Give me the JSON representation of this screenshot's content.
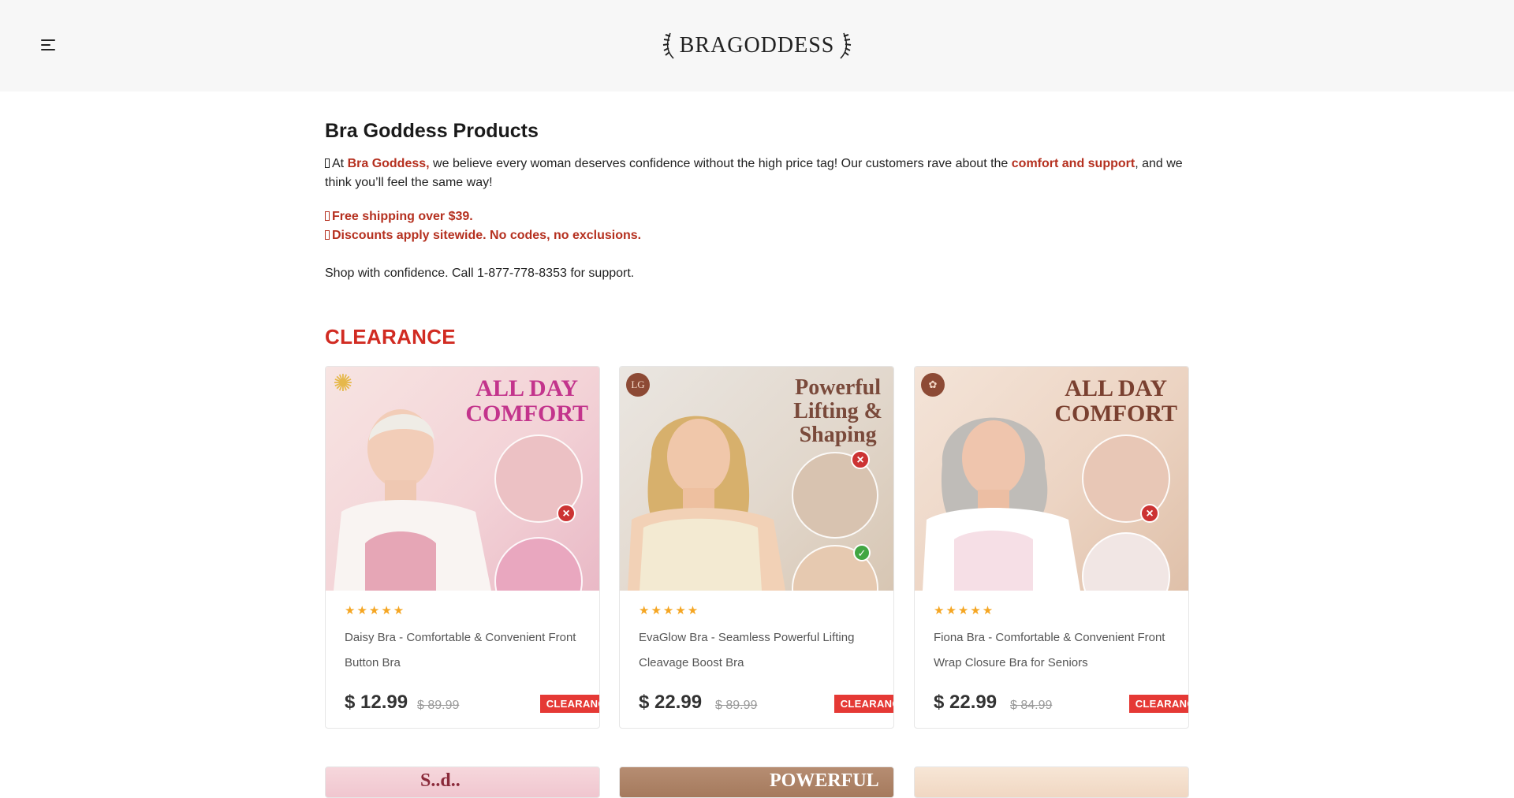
{
  "header": {
    "menu_icon": "hamburger-menu-icon",
    "logo_text": "BRAGODDESS"
  },
  "page": {
    "title": "Bra Goddess Products",
    "intro": {
      "prefix": "At ",
      "brand": "Bra Goddess,",
      "middle": " we believe every woman deserves confidence without the high price tag! Our customers rave about the ",
      "emphasis": "comfort and support",
      "suffix": ", and we think you’ll feel the same way!"
    },
    "promo_1": "Free shipping over $39.",
    "promo_2": "Discounts apply sitewide. No codes, no exclusions.",
    "support": "Shop with confidence. Call 1-877-778-8353 for support."
  },
  "section_title": "CLEARANCE",
  "products": [
    {
      "image_headline": [
        "ALL DAY",
        "COMFORT"
      ],
      "rating": "★★★★★",
      "name": "Daisy Bra - Comfortable & Convenient Front Button Bra",
      "price": "$ 12.99",
      "old_price": "$ 89.99",
      "tag": "CLEARANCE"
    },
    {
      "image_headline": [
        "Powerful",
        "Lifting &",
        "Shaping"
      ],
      "rating": "★★★★★",
      "name": "EvaGlow Bra - Seamless Powerful Lifting Cleavage Boost Bra",
      "price": "$ 22.99",
      "old_price": "$ 89.99",
      "tag": "CLEARANCE"
    },
    {
      "image_headline": [
        "ALL DAY",
        "COMFORT"
      ],
      "rating": "★★★★★",
      "name": "Fiona Bra - Comfortable & Convenient Front Wrap Closure Bra for Seniors",
      "price": "$ 22.99",
      "old_price": "$ 84.99",
      "tag": "CLEARANCE"
    }
  ],
  "next_row": [
    "S..d..",
    "POWERFUL",
    ""
  ],
  "colors": {
    "accent_red": "#d12b22",
    "highlight": "#b5301f",
    "star": "#f5a623",
    "tag_bg": "#e53935"
  }
}
